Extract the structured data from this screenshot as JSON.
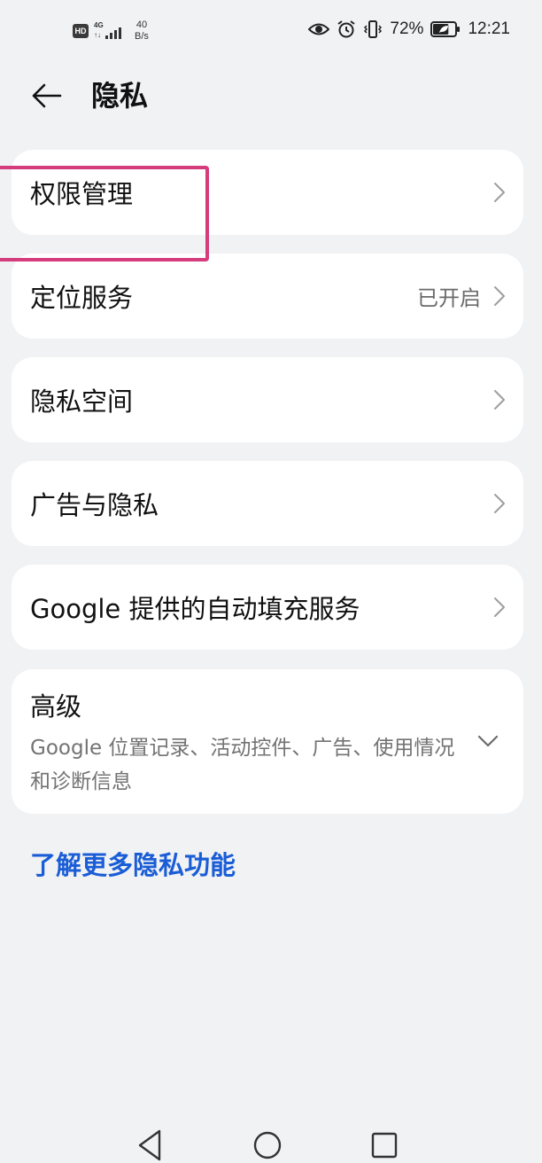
{
  "status_bar": {
    "hd": "HD",
    "network": "4G",
    "network_arrows": "↑↓",
    "speed_value": "40",
    "speed_unit": "B/s",
    "icons": [
      "eye-icon",
      "alarm-icon",
      "vibrate-icon"
    ],
    "battery_percent": "72%",
    "battery_level": 0.72,
    "time": "12:21"
  },
  "header": {
    "title": "隐私",
    "back_icon": "arrow-left-icon"
  },
  "menu": {
    "permissions": {
      "label": "权限管理"
    },
    "location": {
      "label": "定位服务",
      "value": "已开启"
    },
    "private_space": {
      "label": "隐私空间"
    },
    "ads_privacy": {
      "label": "广告与隐私"
    },
    "autofill": {
      "label": "Google 提供的自动填充服务"
    },
    "advanced": {
      "title": "高级",
      "description": "Google 位置记录、活动控件、广告、使用情况和诊断信息"
    }
  },
  "learn_more": "了解更多隐私功能",
  "colors": {
    "background": "#f1f2f4",
    "card": "#ffffff",
    "link": "#1a5dd6",
    "highlight": "#d43c7c",
    "secondary_text": "#737373"
  },
  "nav_bar": {
    "icons": [
      "back-triangle-icon",
      "home-circle-icon",
      "recents-square-icon"
    ]
  }
}
